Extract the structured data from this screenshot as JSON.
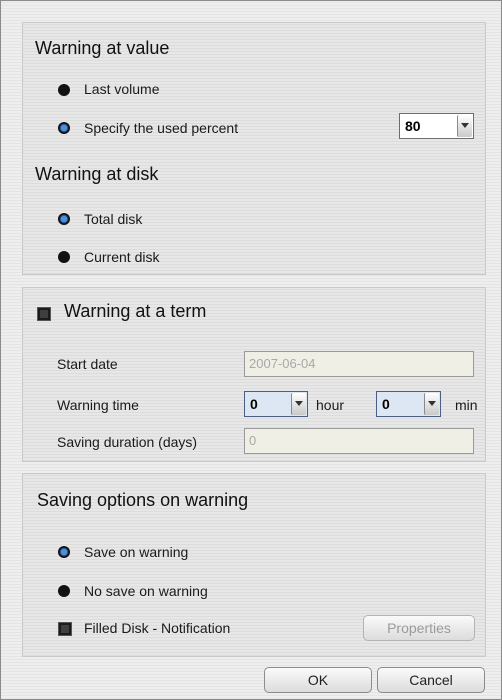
{
  "value_section": {
    "title": "Warning at value",
    "options": [
      {
        "label": "Last volume",
        "selected": false
      },
      {
        "label": "Specify the used percent",
        "selected": true
      }
    ],
    "percent_value": "80"
  },
  "disk_section": {
    "title": "Warning at disk",
    "options": [
      {
        "label": "Total disk",
        "selected": true
      },
      {
        "label": "Current disk",
        "selected": false
      }
    ]
  },
  "term_section": {
    "title": "Warning at a term",
    "checked": false,
    "start_date_label": "Start date",
    "start_date_value": "2007-06-04",
    "warning_time_label": "Warning time",
    "hour_value": "0",
    "hour_unit": "hour",
    "min_value": "0",
    "min_unit": "min",
    "saving_duration_label": "Saving duration (days)",
    "saving_duration_value": "0"
  },
  "saving_section": {
    "title": "Saving options on warning",
    "options": [
      {
        "label": "Save on warning",
        "selected": true
      },
      {
        "label": "No save on warning",
        "selected": false
      }
    ],
    "filled_disk_label": "Filled Disk - Notification",
    "filled_disk_checked": false,
    "properties_label": "Properties"
  },
  "footer": {
    "ok_label": "OK",
    "cancel_label": "Cancel"
  },
  "colors": {
    "radio_selected": "#4f8fd6",
    "radio_unselected": "#111111",
    "disabled_text": "#9a9a9a"
  }
}
